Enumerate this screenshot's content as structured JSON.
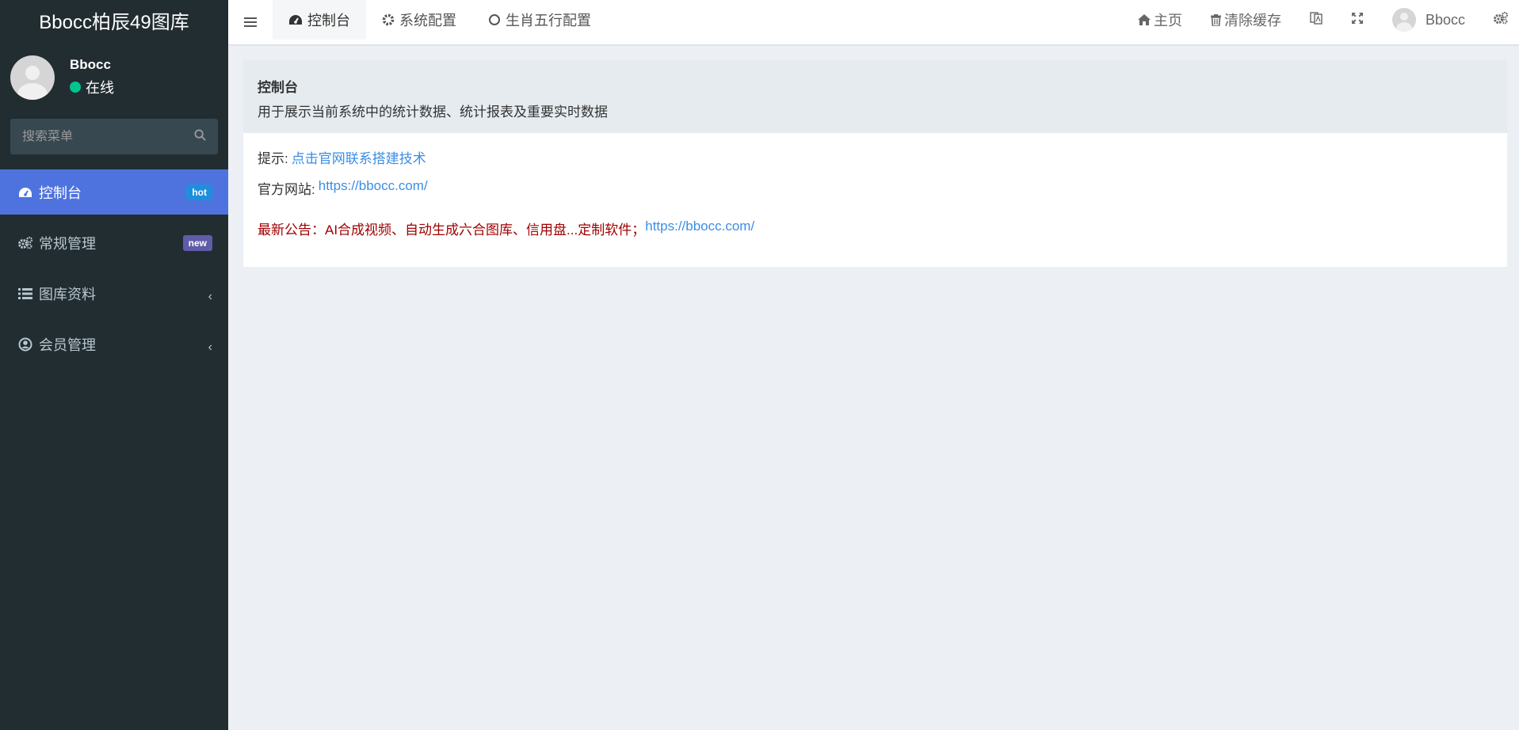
{
  "sidebar": {
    "logo": "Bbocc柏辰49图库",
    "user": {
      "name": "Bbocc",
      "status": "在线"
    },
    "search_placeholder": "搜索菜单",
    "items": [
      {
        "label": "控制台",
        "badge": "hot"
      },
      {
        "label": "常规管理",
        "badge": "new"
      },
      {
        "label": "图库资料"
      },
      {
        "label": "会员管理"
      }
    ]
  },
  "header": {
    "tabs": [
      {
        "label": "控制台"
      },
      {
        "label": "系统配置"
      },
      {
        "label": "生肖五行配置"
      }
    ],
    "right": {
      "home": "主页",
      "clear_cache": "清除缓存",
      "user_name": "Bbocc"
    }
  },
  "main": {
    "title": "控制台",
    "description": "用于展示当前系统中的统计数据、统计报表及重要实时数据",
    "tip_label": "提示:",
    "tip_link": "点击官网联系搭建技术",
    "website_label": "官方网站:",
    "website_link": "https://bbocc.com/",
    "notice_text": "最新公告：AI合成视频、自动生成六合图库、信用盘...定制软件；",
    "notice_link": "https://bbocc.com/"
  },
  "colors": {
    "sidebar_bg": "#222d32",
    "active_menu": "#4e73df",
    "link": "#3a8ee6",
    "notice": "#a10000",
    "status_online": "#00c58e"
  }
}
